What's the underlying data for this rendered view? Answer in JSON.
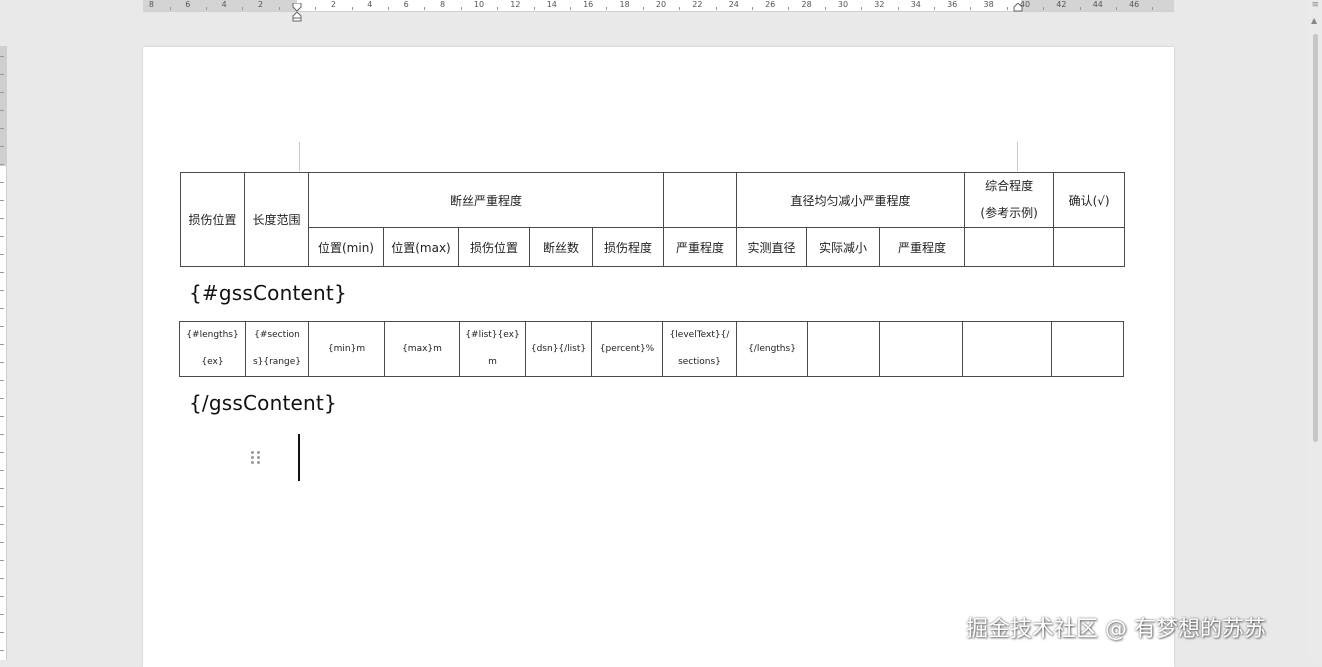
{
  "ruler": {
    "labels": [
      "8",
      "6",
      "4",
      "2",
      "2",
      "4",
      "6",
      "8",
      "10",
      "12",
      "14",
      "16",
      "18",
      "20",
      "22",
      "24",
      "26",
      "28",
      "30",
      "32",
      "34",
      "36",
      "38",
      "40",
      "42",
      "44",
      "46"
    ]
  },
  "header_table": {
    "row1": {
      "damage_position": "损伤位置",
      "length_range": "长度范围",
      "broken_wire_severity": "断丝严重程度",
      "diameter_severity": "直径均匀减小严重程度",
      "overall_degree_line1": "综合程度",
      "overall_degree_line2": "(参考示例)",
      "confirm": "确认(√)"
    },
    "row2": [
      "位置(min)",
      "位置(max)",
      "损伤位置",
      "断丝数",
      "损伤程度",
      "严重程度",
      "实测直径",
      "实际减小",
      "严重程度"
    ]
  },
  "open_tag": "{#gssContent}",
  "close_tag": "{/gssContent}",
  "data_table": {
    "cells": [
      {
        "l1": "{#lengths}",
        "l2": "{ex}"
      },
      {
        "l1": "{#section",
        "l2": "s}{range}"
      },
      {
        "l1": "{min}m",
        "l2": ""
      },
      {
        "l1": "{max}m",
        "l2": ""
      },
      {
        "l1": "{#list}{ex}",
        "l2": "m"
      },
      {
        "l1": "{dsn}{/list}",
        "l2": ""
      },
      {
        "l1": "{percent}%",
        "l2": ""
      },
      {
        "l1": "{levelText}{/",
        "l2": "sections}"
      },
      {
        "l1": "{/lengths}",
        "l2": ""
      },
      {
        "l1": "",
        "l2": ""
      },
      {
        "l1": "",
        "l2": ""
      },
      {
        "l1": "",
        "l2": ""
      },
      {
        "l1": "",
        "l2": ""
      }
    ]
  },
  "watermark": "掘金技术社区 @ 有梦想的苏苏",
  "icons": {
    "drag_handle": "drag-handle-icon",
    "scroll_up": "scroll-up-arrow-icon",
    "corner": "ruler-toggle-icon"
  }
}
